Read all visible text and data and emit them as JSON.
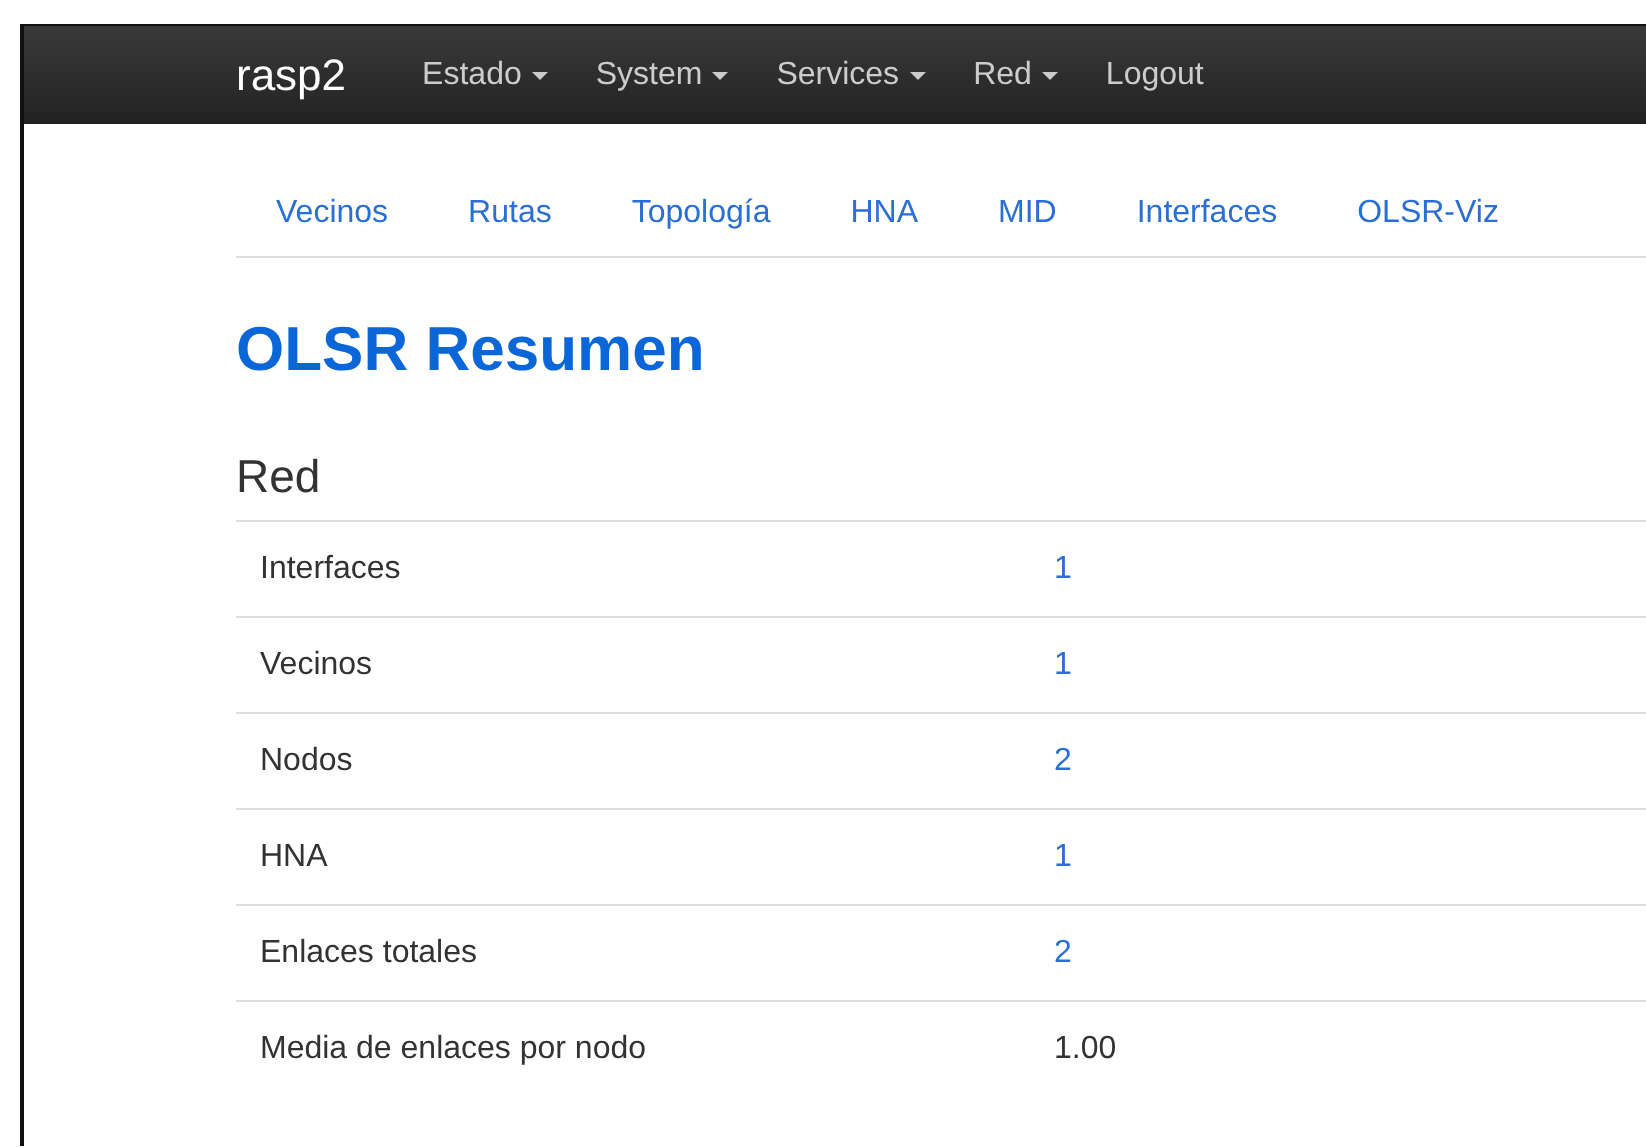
{
  "navbar": {
    "brand": "rasp2",
    "menus": [
      {
        "label": "Estado",
        "dropdown": true
      },
      {
        "label": "System",
        "dropdown": true
      },
      {
        "label": "Services",
        "dropdown": true
      },
      {
        "label": "Red",
        "dropdown": true
      },
      {
        "label": "Logout",
        "dropdown": false
      }
    ]
  },
  "tabs": [
    "Vecinos",
    "Rutas",
    "Topología",
    "HNA",
    "MID",
    "Interfaces",
    "OLSR-Viz"
  ],
  "title": "OLSR Resumen",
  "section": "Red",
  "table": {
    "rows": [
      {
        "label": "Interfaces",
        "value": "1",
        "kind": "link"
      },
      {
        "label": "Vecinos",
        "value": "1",
        "kind": "link"
      },
      {
        "label": "Nodos",
        "value": "2",
        "kind": "link"
      },
      {
        "label": "HNA",
        "value": "1",
        "kind": "link"
      },
      {
        "label": "Enlaces totales",
        "value": "2",
        "kind": "link"
      },
      {
        "label": "Media de enlaces por nodo",
        "value": "1.00",
        "kind": "text"
      }
    ]
  }
}
